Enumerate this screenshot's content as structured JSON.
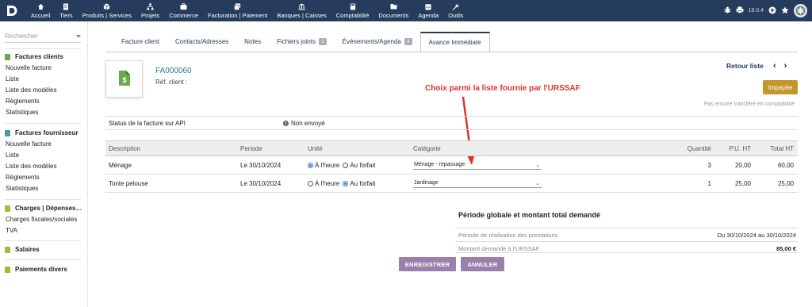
{
  "topbar": {
    "menu": [
      {
        "label": "Accueil",
        "icon": "home-icon"
      },
      {
        "label": "Tiers",
        "icon": "building-icon"
      },
      {
        "label": "Produits | Services",
        "icon": "cube-icon"
      },
      {
        "label": "Projets",
        "icon": "sitemap-icon"
      },
      {
        "label": "Commerce",
        "icon": "briefcase-icon"
      },
      {
        "label": "Facturation | Paiement",
        "icon": "invoice-icon"
      },
      {
        "label": "Banques | Caisses",
        "icon": "bank-icon"
      },
      {
        "label": "Comptabilité",
        "icon": "calculator-icon"
      },
      {
        "label": "Documents",
        "icon": "folder-icon"
      },
      {
        "label": "Agenda",
        "icon": "calendar-icon"
      },
      {
        "label": "Outils",
        "icon": "wrench-icon"
      }
    ],
    "version": "18.0.4",
    "colors": {
      "bar": "#263c5c",
      "text": "#ffffff"
    }
  },
  "sidebar": {
    "search_placeholder": "Rechercher",
    "sections": [
      {
        "title": "Factures clients",
        "color": "#6aa84f",
        "items": [
          "Nouvelle facture",
          "Liste",
          "Liste des modèles",
          "Règlements",
          "Statistiques"
        ]
      },
      {
        "title": "Factures fournisseur",
        "color": "#4a9ba6",
        "items": [
          "Nouvelle facture",
          "Liste",
          "Liste des modèles",
          "Règlements",
          "Statistiques"
        ]
      },
      {
        "title": "Charges | Dépenses…",
        "color": "#a8b83a",
        "items": [
          "Charges fiscales/sociales",
          "TVA"
        ]
      },
      {
        "title": "Salaires",
        "color": "#a8b83a",
        "items": []
      },
      {
        "title": "Paiements divers",
        "color": "#a8b83a",
        "items": []
      }
    ]
  },
  "tabs": [
    {
      "label": "Facture client"
    },
    {
      "label": "Contacts/Adresses"
    },
    {
      "label": "Notes"
    },
    {
      "label": "Fichiers joints",
      "badge": "1"
    },
    {
      "label": "Événements/Agenda",
      "badge": "3"
    },
    {
      "label": "Avance Immédiate",
      "active": true
    }
  ],
  "invoice": {
    "ref": "FA000060",
    "ref_client_label": "Réf. client :",
    "back_link": "Retour liste",
    "status": "Impayée",
    "transfer_note": "Pas encore transféré en comptabilité"
  },
  "annotation": "Choix parmi la liste fournie par l'URSSAF",
  "api": {
    "label": "Status de la facture sur API",
    "value": "Non envoyé"
  },
  "lines": {
    "headers": {
      "desc": "Description",
      "period": "Periode",
      "unit": "Unité",
      "category": "Catégorie",
      "qty": "Quantité",
      "pu": "P.U. HT",
      "total": "Total HT"
    },
    "unit_options": [
      "À l'heure",
      "Au forfait"
    ],
    "rows": [
      {
        "desc": "Ménage",
        "period": "Le 30/10/2024",
        "unit_selected": 0,
        "category": "Ménage - repassage",
        "qty": "3",
        "pu": "20,00",
        "total": "60,00"
      },
      {
        "desc": "Tonte pelouse",
        "period": "Le 30/10/2024",
        "unit_selected": 1,
        "category": "Jardinage",
        "qty": "1",
        "pu": "25,00",
        "total": "25,00"
      }
    ]
  },
  "summary": {
    "title": "Période globale et montant total demandé",
    "period_label": "Période de réalisation des prestations",
    "period_value": "Du 30/10/2024 au 30/10/2024",
    "amount_label": "Montant demandé à l'URSSAF",
    "amount_value": "85,00 €"
  },
  "buttons": {
    "save": "ENREGISTRER",
    "cancel": "ANNULER"
  }
}
